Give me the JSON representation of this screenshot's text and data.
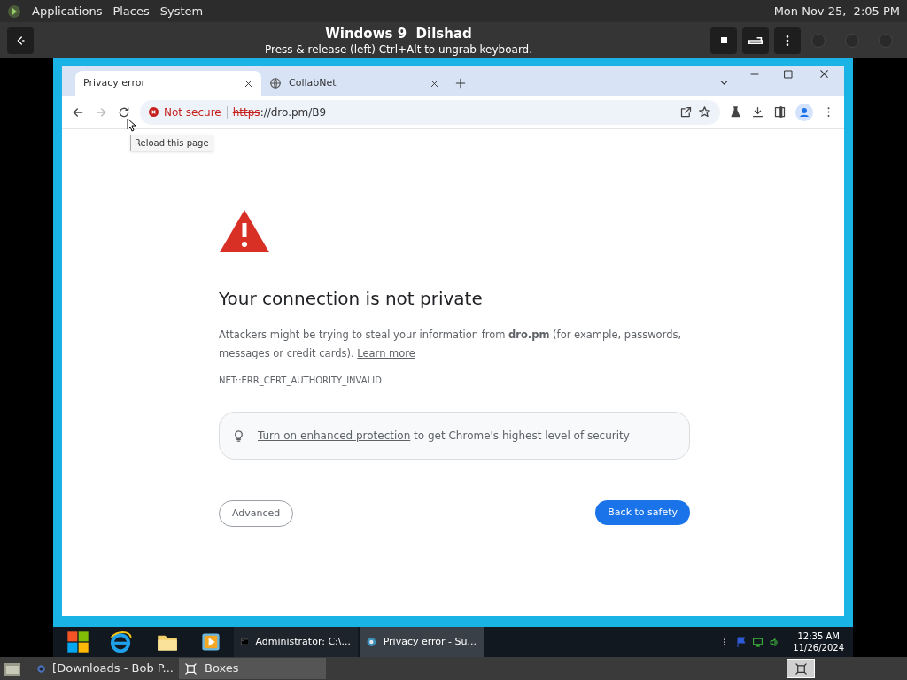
{
  "top_bar": {
    "menus": [
      "Applications",
      "Places",
      "System"
    ],
    "clock": "Mon Nov 25,  2:05 PM"
  },
  "boxes_header": {
    "title": "Windows 9  Dilshad",
    "subtitle": "Press & release (left) Ctrl+Alt to ungrab keyboard."
  },
  "browser": {
    "tabs": [
      {
        "label": "Privacy error",
        "selected": true,
        "kind": "page"
      },
      {
        "label": "CollabNet",
        "selected": false,
        "kind": "globe"
      }
    ],
    "address": {
      "security": "Not secure",
      "scheme": "https",
      "rest": "://dro.pm/B9"
    },
    "tooltip": "Reload this page",
    "error": {
      "heading": "Your connection is not private",
      "message": "Attackers might be trying to steal your information from **dro.pm** (for example, passwords, messages or credit cards). ",
      "learn_more": "Learn more",
      "code": "NET::ERR_CERT_AUTHORITY_INVALID",
      "protection_link": "Turn on enhanced protection",
      "protection_text": " to get Chrome's highest level of security",
      "advanced": "Advanced",
      "back": "Back to safety"
    }
  },
  "win_taskbar": {
    "windows": [
      {
        "label": "Administrator: C:\\...",
        "kind": "cmd",
        "selected": false
      },
      {
        "label": "Privacy error - Su...",
        "kind": "chrome",
        "selected": true
      }
    ],
    "time": "12:35 AM",
    "date": "11/26/2024"
  },
  "bottom_bar": {
    "windows": [
      {
        "label": "[Downloads - Bob P...",
        "selected": false,
        "kind": "browser"
      },
      {
        "label": "Boxes",
        "selected": true,
        "kind": "boxes"
      }
    ]
  }
}
